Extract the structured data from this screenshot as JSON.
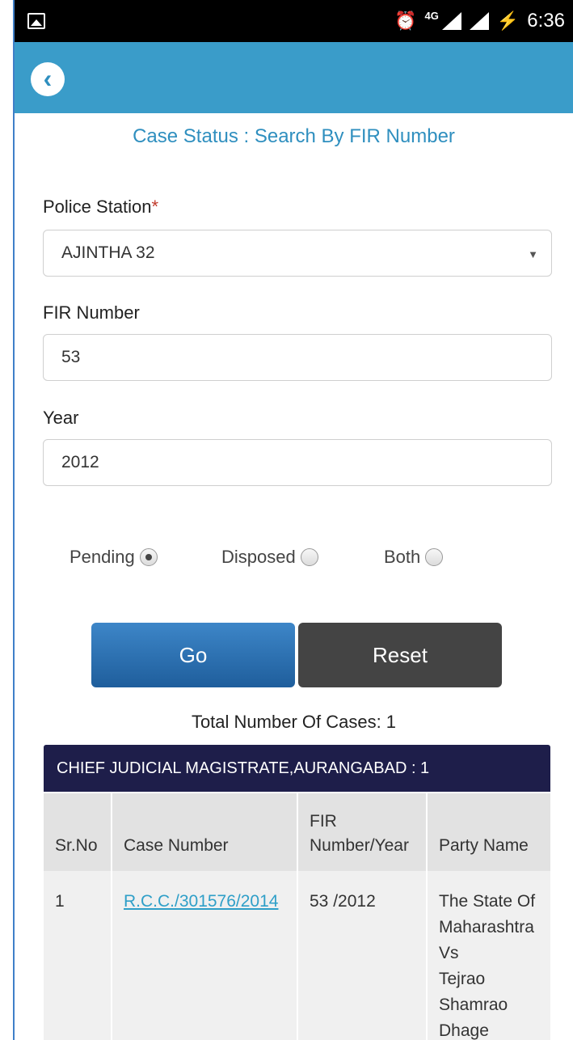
{
  "status_bar": {
    "time": "6:36",
    "network": "4G",
    "icons": [
      "image-icon",
      "alarm-icon",
      "signal-4g-icon",
      "signal-icon",
      "battery-charging-icon"
    ]
  },
  "header": {
    "back_icon": "chevron-left-icon",
    "accent_color": "#3a9cc9"
  },
  "page": {
    "title": "Case Status : Search By FIR Number"
  },
  "form": {
    "police_station": {
      "label": "Police Station",
      "required_mark": "*",
      "value": "AJINTHA 32"
    },
    "fir_number": {
      "label": "FIR Number",
      "value": "53"
    },
    "year": {
      "label": "Year",
      "value": "2012"
    },
    "case_type": {
      "options": [
        {
          "label": "Pending",
          "selected": true
        },
        {
          "label": "Disposed",
          "selected": false
        },
        {
          "label": "Both",
          "selected": false
        }
      ]
    },
    "go_label": "Go",
    "reset_label": "Reset"
  },
  "results": {
    "total_text": "Total Number Of Cases: 1",
    "court": "CHIEF JUDICIAL MAGISTRATE,AURANGABAD : 1",
    "columns": [
      "Sr.No",
      "Case Number",
      "FIR",
      "Number/Year",
      "Party Name"
    ],
    "rows": [
      {
        "sr_no": "1",
        "case_number": "R.C.C./301576/2014",
        "fir_number_year": "53 /2012",
        "party_lines": [
          "The State Of",
          "Maharashtra",
          "Vs",
          "Tejrao",
          "Shamrao",
          "Dhage"
        ]
      }
    ]
  }
}
